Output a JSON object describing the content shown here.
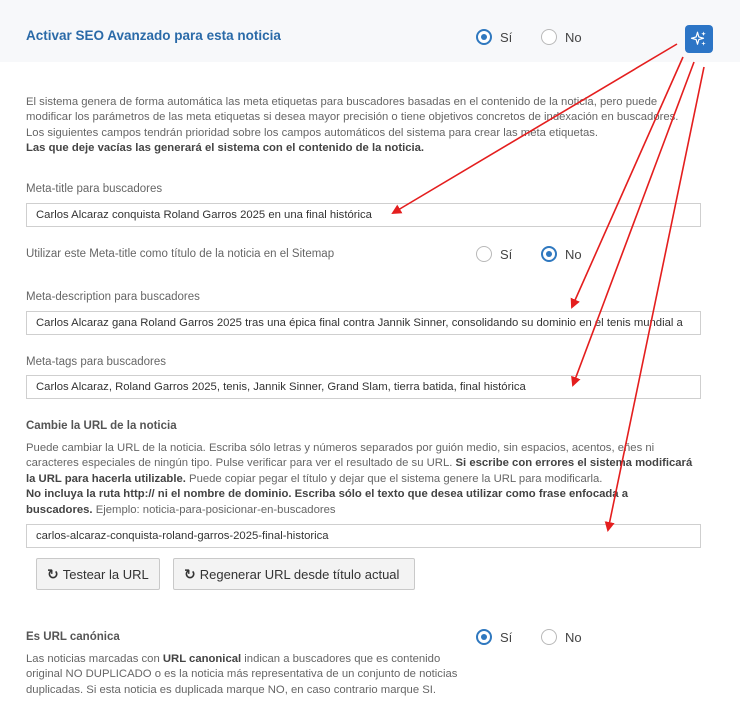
{
  "seo_toggle": {
    "title": "Activar SEO Avanzado para esta noticia",
    "yes_label": "Sí",
    "no_label": "No",
    "selected": "yes"
  },
  "ai_button": {
    "icon": "sparkles-icon"
  },
  "intro": {
    "line1": "El sistema genera de forma automática las meta etiquetas para buscadores basadas en el contenido de la noticia, pero puede",
    "line2": "modificar los parámetros de las meta etiquetas si desea mayor precisión o tiene objetivos concretos de indexación en buscadores.",
    "line3": "Los siguientes campos tendrán prioridad sobre los campos automáticos del sistema para crear las meta etiquetas.",
    "line4_bold": "Las que deje vacías las generará el sistema con el contenido de la noticia."
  },
  "meta_title": {
    "label": "Meta-title para buscadores",
    "value": "Carlos Alcaraz conquista Roland Garros 2025 en una final histórica"
  },
  "sitemap_toggle": {
    "label": "Utilizar este Meta-title como título de la noticia en el Sitemap",
    "yes_label": "Sí",
    "no_label": "No",
    "selected": "no"
  },
  "meta_description": {
    "label": "Meta-description para buscadores",
    "value": "Carlos Alcaraz gana Roland Garros 2025 tras una épica final contra Jannik Sinner, consolidando su dominio en el tenis mundial a"
  },
  "meta_tags": {
    "label": "Meta-tags para buscadores",
    "value": "Carlos Alcaraz, Roland Garros 2025, tenis, Jannik Sinner, Grand Slam, tierra batida, final histórica"
  },
  "url_section": {
    "title": "Cambie la URL de la noticia",
    "d1": "Puede cambiar la URL de la noticia. Escriba sólo letras y números separados por guión medio, sin espacios, acentos, eñes ni",
    "d2a": "caracteres especiales de ningún tipo. Pulse verificar para ver el resultado de su URL. ",
    "d2b": "Si escribe con errores el sistema modificará",
    "d3a": "la URL para hacerla utilizable.",
    "d3b": " Puede copiar pegar el título y dejar que el sistema genere la URL para modificarla.",
    "d4": "No incluya la ruta http:// ni el nombre de dominio. Escriba sólo el texto que desea utilizar como frase enfocada a",
    "d5a": "buscadores.",
    "d5b": " Ejemplo: noticia-para-posicionar-en-buscadores",
    "value": "carlos-alcaraz-conquista-roland-garros-2025-final-historica",
    "test_button": "Testear la URL",
    "regen_button": "Regenerar URL desde título actual"
  },
  "canonical": {
    "title": "Es URL canónica",
    "yes_label": "Sí",
    "no_label": "No",
    "selected": "yes",
    "d1a": "Las noticias marcadas con ",
    "d1b": "URL canonical",
    "d1c": " indican a buscadores que es contenido",
    "d2": "original NO DUPLICADO o es la noticia más representativa de un conjunto de noticias",
    "d3": "duplicadas. Si esta noticia es duplicada marque NO, en caso contrario marque SI."
  },
  "colors": {
    "accent": "#2c75c6",
    "title": "#2a6aa8",
    "arrow": "#e41e1e"
  }
}
